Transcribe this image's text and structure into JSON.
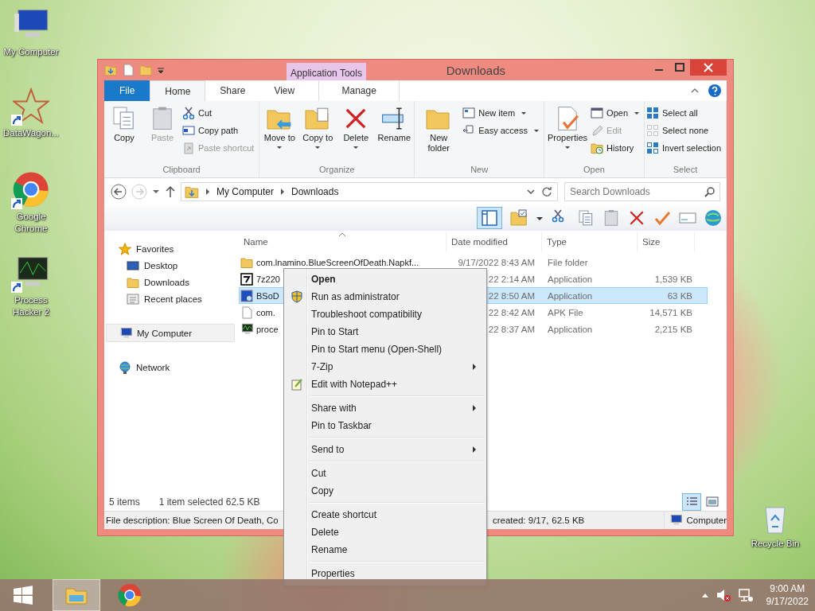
{
  "desktop_icons": [
    {
      "label": "My Computer",
      "kind": "computer",
      "shortcut": false
    },
    {
      "label": "DataWagon...",
      "kind": "star",
      "shortcut": true
    },
    {
      "label": "Google Chrome",
      "kind": "chrome",
      "shortcut": true
    },
    {
      "label": "Process Hacker 2",
      "kind": "monitor",
      "shortcut": true
    }
  ],
  "recycle_bin": {
    "label": "Recycle Bin"
  },
  "window": {
    "title": "Downloads",
    "contextual_group": "Application Tools",
    "tabs": [
      {
        "label": "File",
        "kind": "file",
        "selected": false
      },
      {
        "label": "Home",
        "kind": "tab",
        "selected": true
      },
      {
        "label": "Share",
        "kind": "tab",
        "selected": false
      },
      {
        "label": "View",
        "kind": "tab",
        "selected": false
      },
      {
        "label": "Manage",
        "kind": "contextual",
        "selected": false
      }
    ],
    "ribbon_groups": [
      {
        "name": "Clipboard",
        "large": [
          {
            "label": "Copy",
            "kind": "copy",
            "disabled": false,
            "dropdown": false
          },
          {
            "label": "Paste",
            "kind": "paste",
            "disabled": true,
            "dropdown": false
          }
        ],
        "small": [
          {
            "label": "Cut",
            "kind": "cut",
            "disabled": false,
            "dropdown": false
          },
          {
            "label": "Copy path",
            "kind": "copy-path",
            "disabled": false,
            "dropdown": false
          },
          {
            "label": "Paste shortcut",
            "kind": "paste-shortcut",
            "disabled": true,
            "dropdown": false
          }
        ]
      },
      {
        "name": "Organize",
        "large": [
          {
            "label": "Move to",
            "kind": "move-to",
            "disabled": false,
            "dropdown": true
          },
          {
            "label": "Copy to",
            "kind": "copy-to",
            "disabled": false,
            "dropdown": true
          },
          {
            "label": "Delete",
            "kind": "delete",
            "disabled": false,
            "dropdown": true
          },
          {
            "label": "Rename",
            "kind": "rename",
            "disabled": false,
            "dropdown": false
          }
        ]
      },
      {
        "name": "New",
        "large": [
          {
            "label": "New folder",
            "kind": "new-folder",
            "disabled": false,
            "dropdown": false
          }
        ],
        "small": [
          {
            "label": "New item",
            "kind": "new-item",
            "disabled": false,
            "dropdown": true
          },
          {
            "label": "Easy access",
            "kind": "easy-access",
            "disabled": false,
            "dropdown": true
          }
        ]
      },
      {
        "name": "Open",
        "large": [
          {
            "label": "Properties",
            "kind": "properties",
            "disabled": false,
            "dropdown": true
          }
        ],
        "small": [
          {
            "label": "Open",
            "kind": "open",
            "disabled": false,
            "dropdown": true
          },
          {
            "label": "Edit",
            "kind": "edit",
            "disabled": true,
            "dropdown": false
          },
          {
            "label": "History",
            "kind": "history",
            "disabled": false,
            "dropdown": false
          }
        ]
      },
      {
        "name": "Select",
        "small": [
          {
            "label": "Select all",
            "kind": "select-all",
            "disabled": false,
            "dropdown": false
          },
          {
            "label": "Select none",
            "kind": "select-none",
            "disabled": false,
            "dropdown": false
          },
          {
            "label": "Invert selection",
            "kind": "invert",
            "disabled": false,
            "dropdown": false
          }
        ]
      }
    ],
    "address": {
      "path": [
        "My Computer",
        "Downloads"
      ]
    },
    "search": {
      "placeholder": "Search Downloads"
    },
    "nav": [
      {
        "label": "Favorites",
        "kind": "star",
        "selected": false,
        "children": [
          {
            "label": "Desktop",
            "kind": "desktop",
            "selected": false
          },
          {
            "label": "Downloads",
            "kind": "downloads",
            "selected": false
          },
          {
            "label": "Recent places",
            "kind": "recent",
            "selected": false
          }
        ]
      },
      {
        "label": "My Computer",
        "kind": "computer",
        "selected": true
      },
      {
        "label": "Network",
        "kind": "network",
        "selected": false
      }
    ],
    "columns": [
      "Name",
      "Date modified",
      "Type",
      "Size"
    ],
    "rows": [
      {
        "name": "com.lnamino.BlueScreenOfDeath.Napkf...",
        "date": "9/17/2022 8:43 AM",
        "type": "File folder",
        "size": "",
        "kind": "folder",
        "selected": false
      },
      {
        "name": "7z220",
        "date": "22 2:14 AM",
        "type": "Application",
        "size": "1,539 KB",
        "kind": "archive",
        "selected": false
      },
      {
        "name": "BSoD",
        "date": "22 8:50 AM",
        "type": "Application",
        "size": "63 KB",
        "kind": "bsod",
        "selected": true
      },
      {
        "name": "com.",
        "date": "22 8:42 AM",
        "type": "APK File",
        "size": "14,571 KB",
        "kind": "file",
        "selected": false
      },
      {
        "name": "proce",
        "date": "22 8:37 AM",
        "type": "Application",
        "size": "2,215 KB",
        "kind": "monitor",
        "selected": false
      }
    ],
    "status": {
      "count": "5 items",
      "selection": "1 item selected  62.5 KB"
    },
    "view_buttons": [
      {
        "kind": "details",
        "selected": true
      },
      {
        "kind": "tiles",
        "selected": false
      }
    ],
    "details_bar": {
      "description": "File description: Blue Screen Of Death, Co",
      "created": "created: 9/17,",
      "size": "62.5 KB",
      "location": "Computer"
    }
  },
  "context_menu": [
    {
      "kind": "item",
      "label": "Open",
      "bold": true,
      "submenu": false
    },
    {
      "kind": "shield",
      "label": "Run as administrator",
      "bold": false,
      "submenu": false
    },
    {
      "kind": "item",
      "label": "Troubleshoot compatibility",
      "bold": false,
      "submenu": false
    },
    {
      "kind": "item",
      "label": "Pin to Start",
      "bold": false,
      "submenu": false
    },
    {
      "kind": "item",
      "label": "Pin to Start menu (Open-Shell)",
      "bold": false,
      "submenu": false
    },
    {
      "kind": "item",
      "label": "7-Zip",
      "bold": false,
      "submenu": true
    },
    {
      "kind": "notepad",
      "label": "Edit with Notepad++",
      "bold": false,
      "submenu": false
    },
    {
      "kind": "separator"
    },
    {
      "kind": "item",
      "label": "Share with",
      "bold": false,
      "submenu": true
    },
    {
      "kind": "item",
      "label": "Pin to Taskbar",
      "bold": false,
      "submenu": false
    },
    {
      "kind": "separator"
    },
    {
      "kind": "item",
      "label": "Send to",
      "bold": false,
      "submenu": true
    },
    {
      "kind": "separator"
    },
    {
      "kind": "item",
      "label": "Cut",
      "bold": false,
      "submenu": false
    },
    {
      "kind": "item",
      "label": "Copy",
      "bold": false,
      "submenu": false
    },
    {
      "kind": "separator"
    },
    {
      "kind": "item",
      "label": "Create shortcut",
      "bold": false,
      "submenu": false
    },
    {
      "kind": "item",
      "label": "Delete",
      "bold": false,
      "submenu": false
    },
    {
      "kind": "item",
      "label": "Rename",
      "bold": false,
      "submenu": false
    },
    {
      "kind": "separator"
    },
    {
      "kind": "item",
      "label": "Properties",
      "bold": false,
      "submenu": false
    }
  ],
  "taskbar": {
    "buttons": [
      {
        "kind": "start",
        "selected": false
      },
      {
        "kind": "explorer",
        "selected": true
      },
      {
        "kind": "chrome",
        "selected": false
      }
    ],
    "clock": {
      "time": "9:00 AM",
      "date": "9/17/2022"
    }
  }
}
